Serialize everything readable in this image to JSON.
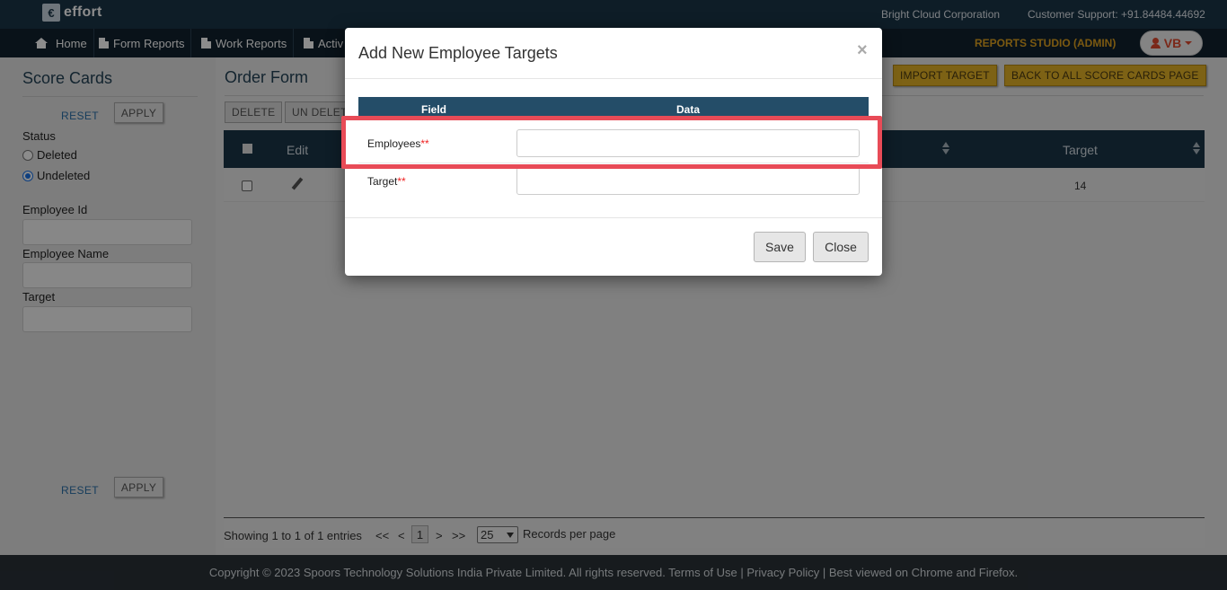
{
  "topbar": {
    "logo_glyph": "€",
    "logo": "effort",
    "org": "Bright Cloud Corporation",
    "support": "Customer Support: +91.84484.44692"
  },
  "nav": {
    "items": [
      {
        "label": "Home",
        "icon": "home-icon"
      },
      {
        "label": "Form Reports",
        "icon": "document-icon"
      },
      {
        "label": "Work Reports",
        "icon": "document-icon"
      },
      {
        "label": "Activ",
        "icon": "document-icon"
      }
    ],
    "studio": "REPORTS STUDIO (ADMIN)",
    "user": "VB"
  },
  "sidebar": {
    "title": "Score Cards",
    "reset": "RESET",
    "apply": "APPLY",
    "status_label": "Status",
    "options": [
      "Deleted",
      "Undeleted"
    ],
    "selected": "Undeleted",
    "fields": [
      "Employee Id",
      "Employee Name",
      "Target"
    ]
  },
  "main": {
    "title": "Order Form",
    "delete": "DELETE",
    "undelete": "UN DELET",
    "import_target": "IMPORT TARGET",
    "back": "BACK TO ALL SCORE CARDS PAGE",
    "columns": {
      "edit": "Edit",
      "target": "Target"
    },
    "rows": [
      {
        "target": "14"
      }
    ]
  },
  "pager": {
    "showing": "Showing 1 to 1 of 1 entries",
    "first": "<<",
    "prev": "<",
    "current": "1",
    "next": ">",
    "last": ">>",
    "per_page": "25",
    "records": "Records per page"
  },
  "footer": {
    "text": "Copyright © 2023 Spoors Technology Solutions India Private Limited. All rights reserved. Terms of Use | Privacy Policy | Best viewed on Chrome and Firefox."
  },
  "modal": {
    "title": "Add New Employee Targets",
    "close": "×",
    "head_field": "Field",
    "head_data": "Data",
    "employees_label": "Employees",
    "target_label": "Target",
    "required": "**",
    "save": "Save",
    "close_btn": "Close",
    "highlight_color": "#e84b57"
  }
}
